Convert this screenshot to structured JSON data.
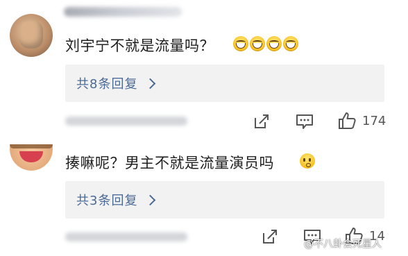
{
  "comments": [
    {
      "text": "刘宇宁不就是流量吗？",
      "emoji_icons": [
        "laughing-tears-icon",
        "laughing-tears-icon",
        "laughing-tears-icon",
        "laughing-tears-icon"
      ],
      "reply_label": "共8条回复",
      "like_count": "174"
    },
    {
      "text": "揍嘛呢？男主不就是流量演员吗",
      "emoji_icons": [
        "thinking-face-icon"
      ],
      "reply_label": "共3条回复",
      "like_count": "14"
    }
  ],
  "watermark": "@不八卦会死星人",
  "colors": {
    "link": "#4a6a95",
    "reply_bg": "#f2f2f2",
    "icon": "#555555"
  }
}
